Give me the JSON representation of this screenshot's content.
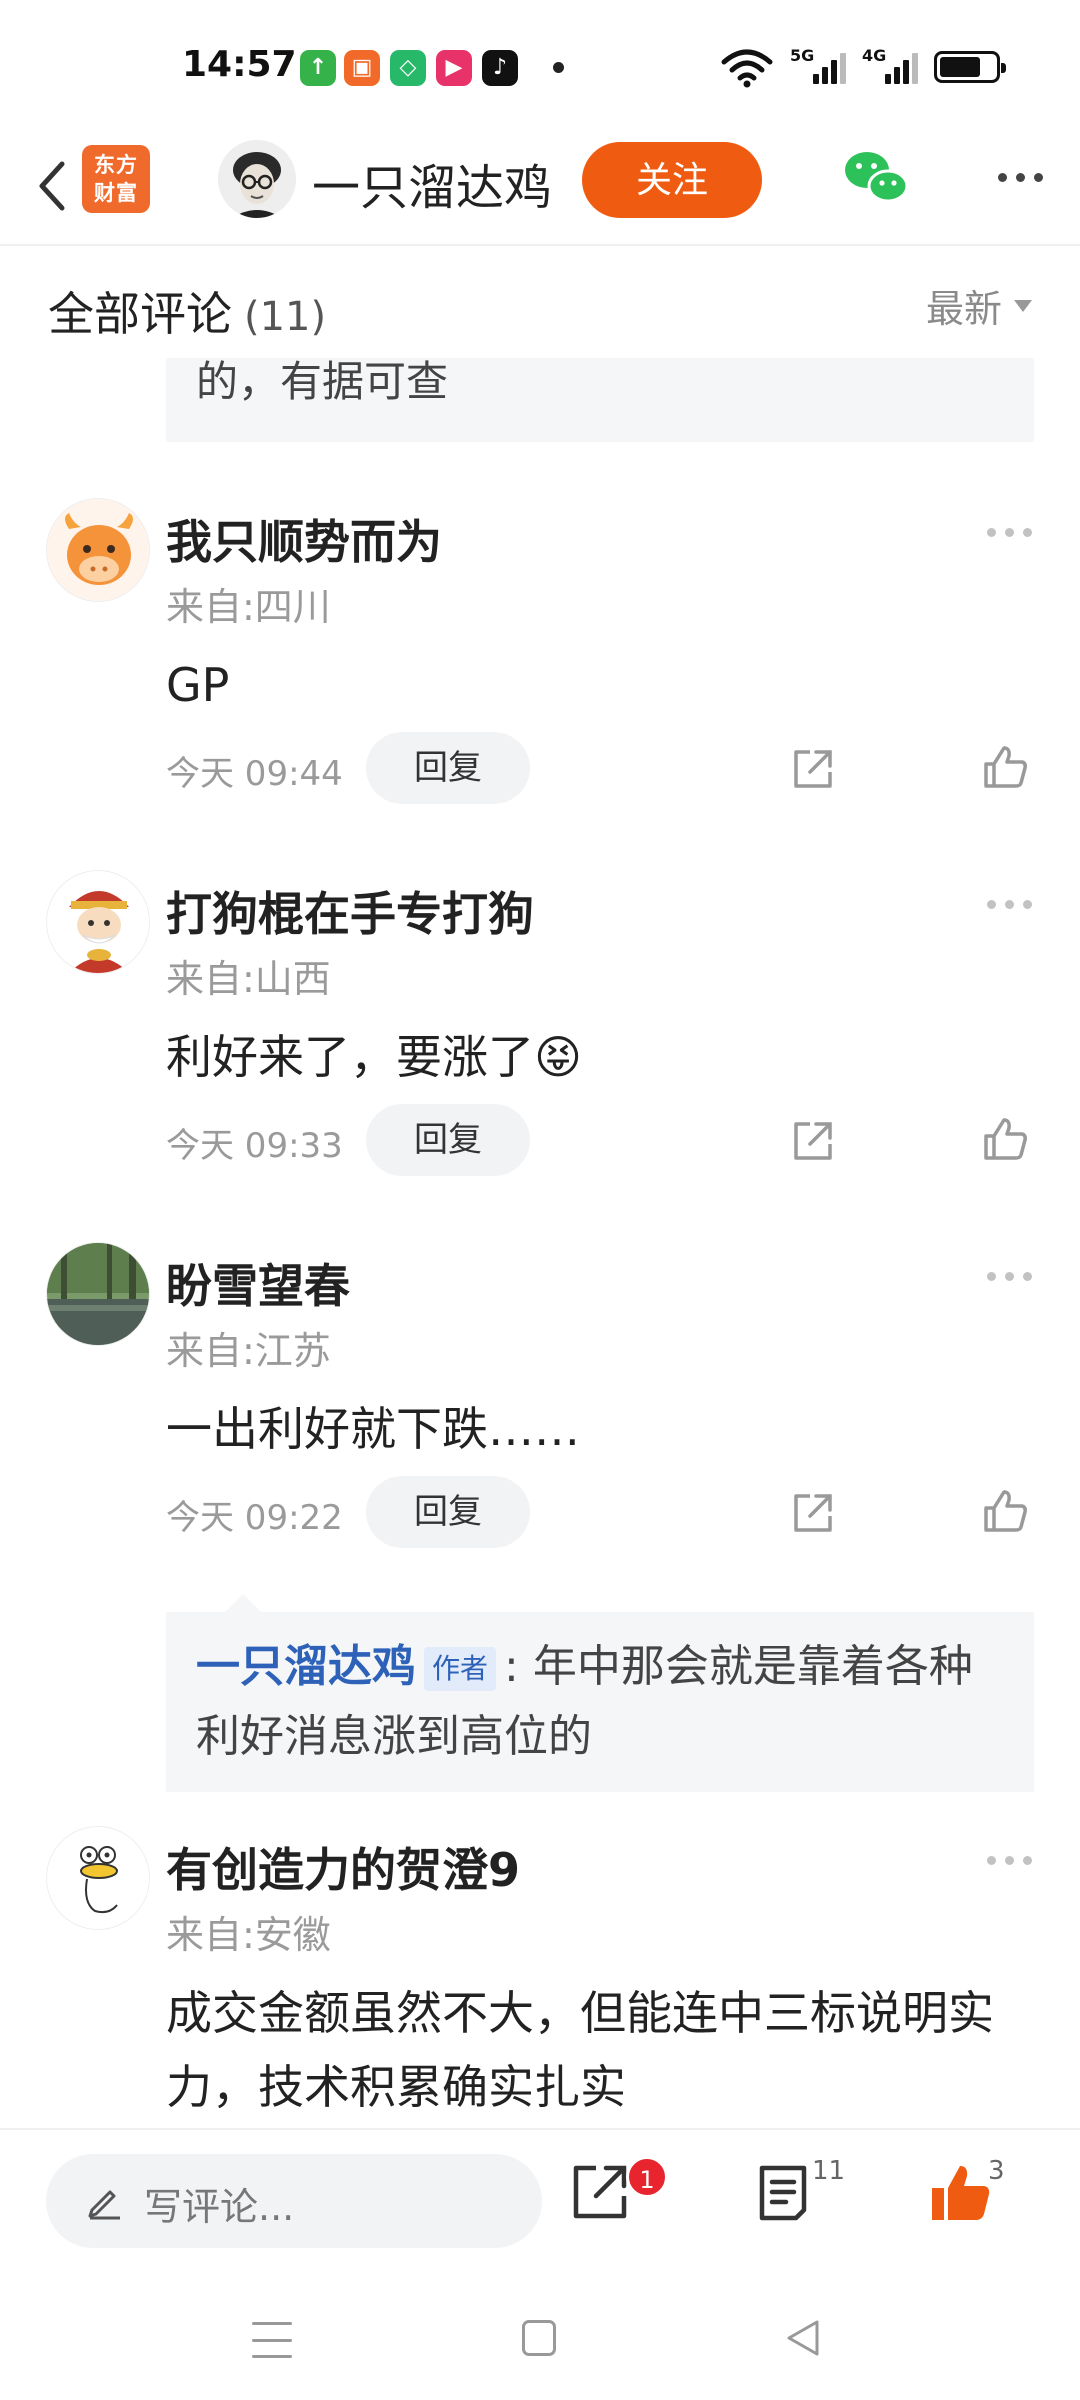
{
  "status_bar": {
    "time": "14:57",
    "net_5g": "5G",
    "net_4g": "4G",
    "app_icons": [
      "upload-app-icon",
      "grid-app-icon",
      "shield-app-icon",
      "video-app-icon",
      "tiktok-icon"
    ],
    "icons": [
      "wifi-icon",
      "signal-5g-icon",
      "signal-4g-icon",
      "battery-icon"
    ]
  },
  "topnav": {
    "back_icon": "chevron-left-icon",
    "logo_line1": "东方",
    "logo_line2": "财富",
    "author": "一只溜达鸡",
    "follow_label": "关注",
    "share_icon": "wechat-icon",
    "more_icon": "more-horizontal-icon",
    "accent_color": "#f05b12"
  },
  "comments_header": {
    "title": "全部评论",
    "count": "(11)",
    "sort_label": "最新"
  },
  "quote_fragment": "的，有据可查",
  "comments": [
    {
      "name": "我只顺势而为",
      "location": "来自:四川",
      "text": "GP",
      "time": "今天 09:44",
      "reply_label": "回复",
      "avatar": "cartoon-bull-avatar"
    },
    {
      "name": "打狗棍在手专打狗",
      "location": "来自:山西",
      "text": "利好来了，要涨了",
      "emoji": "😝",
      "time": "今天 09:33",
      "reply_label": "回复",
      "avatar": "cartoon-god-of-wealth-avatar"
    },
    {
      "name": "盼雪望春",
      "location": "来自:江苏",
      "text": "一出利好就下跌……",
      "time": "今天 09:22",
      "reply_label": "回复",
      "avatar": "landscape-photo-avatar",
      "reply": {
        "author": "一只溜达鸡",
        "tag": "作者",
        "text": ": 年中那会就是靠着各种利好消息涨到高位的"
      }
    },
    {
      "name": "有创造力的贺澄9",
      "location": "来自:安徽",
      "text": "成交金额虽然不大，但能连中三标说明实力，技术积累确实扎实",
      "avatar": "cartoon-duck-avatar"
    }
  ],
  "bottom_bar": {
    "input_placeholder": "写评论...",
    "share_badge": "1",
    "comment_count": "11",
    "like_count": "3",
    "like_color": "#f05b12"
  },
  "nav_bar": {
    "icons": [
      "menu-icon",
      "home-icon",
      "back-icon"
    ]
  }
}
